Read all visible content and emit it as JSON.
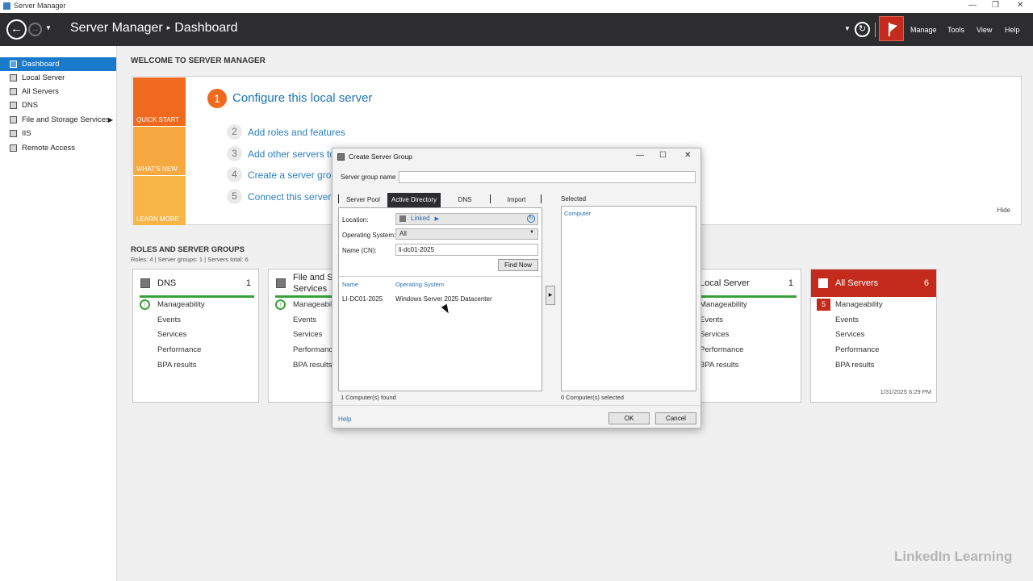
{
  "window": {
    "title": "Server Manager"
  },
  "header": {
    "breadcrumb_root": "Server Manager",
    "breadcrumb_page": "Dashboard",
    "menu": [
      "Manage",
      "Tools",
      "View",
      "Help"
    ]
  },
  "sidebar": {
    "items": [
      {
        "label": "Dashboard",
        "icon": "grid-icon",
        "active": true
      },
      {
        "label": "Local Server",
        "icon": "server-icon"
      },
      {
        "label": "All Servers",
        "icon": "servers-icon"
      },
      {
        "label": "DNS",
        "icon": "dns-icon"
      },
      {
        "label": "File and Storage Services",
        "icon": "storage-icon",
        "expandable": true
      },
      {
        "label": "IIS",
        "icon": "iis-icon"
      },
      {
        "label": "Remote Access",
        "icon": "remote-icon"
      }
    ]
  },
  "welcome": {
    "title": "WELCOME TO SERVER MANAGER",
    "tiles": [
      "QUICK START",
      "WHAT'S NEW",
      "LEARN MORE"
    ],
    "step1": {
      "num": "1",
      "label": "Configure this local server"
    },
    "steps": [
      {
        "num": "2",
        "label": "Add roles and features"
      },
      {
        "num": "3",
        "label": "Add other servers to"
      },
      {
        "num": "4",
        "label": "Create a server grou"
      },
      {
        "num": "5",
        "label": "Connect this server t"
      }
    ],
    "hide": "Hide"
  },
  "roles": {
    "title": "ROLES AND SERVER GROUPS",
    "summary": "Roles: 4   |   Server groups: 1   |   Servers total: 6",
    "cards": [
      {
        "title": "DNS",
        "count": "1",
        "rows": [
          "Manageability",
          "Events",
          "Services",
          "Performance",
          "BPA results"
        ]
      },
      {
        "title": "File and St",
        "title2": "Services",
        "rows": [
          "Manageabili",
          "Events",
          "Services",
          "Performance",
          "BPA results"
        ]
      },
      {
        "title": "Local Server",
        "count": "1",
        "rows": [
          "Manageability",
          "Events",
          "Services",
          "Performance",
          "BPA results"
        ]
      },
      {
        "title": "All Servers",
        "count": "6",
        "badge": "5",
        "date": "1/31/2025 6:29 PM",
        "rows": [
          "Manageability",
          "Events",
          "Services",
          "Performance",
          "BPA results"
        ]
      }
    ]
  },
  "dialog": {
    "title": "Create Server Group",
    "group_name_label": "Server group name",
    "group_name_value": "",
    "tabs": [
      "Server Pool",
      "Active Directory",
      "DNS",
      "Import"
    ],
    "active_tab": "Active Directory",
    "selected_label": "Selected",
    "location_label": "Location:",
    "location_value": "Linked",
    "os_label": "Operating System:",
    "os_value": "All",
    "name_label": "Name (CN):",
    "name_value": "li-dc01-2025",
    "find_now": "Find Now",
    "col_name": "Name",
    "col_os": "Operating System",
    "results": [
      {
        "name": "LI-DC01-2025",
        "os": "Windows Server 2025 Datacenter"
      }
    ],
    "found": "1 Computer(s) found",
    "selected_col": "Computer",
    "selected_count": "0 Computer(s) selected",
    "help": "Help",
    "ok": "OK",
    "cancel": "Cancel"
  },
  "watermark": "LinkedIn Learning",
  "colors": {
    "accent": "#1979ca",
    "header": "#2d2d30",
    "alert": "#c42b1c",
    "quickstart": "#ef6a1e",
    "ok": "#3aa13a"
  }
}
